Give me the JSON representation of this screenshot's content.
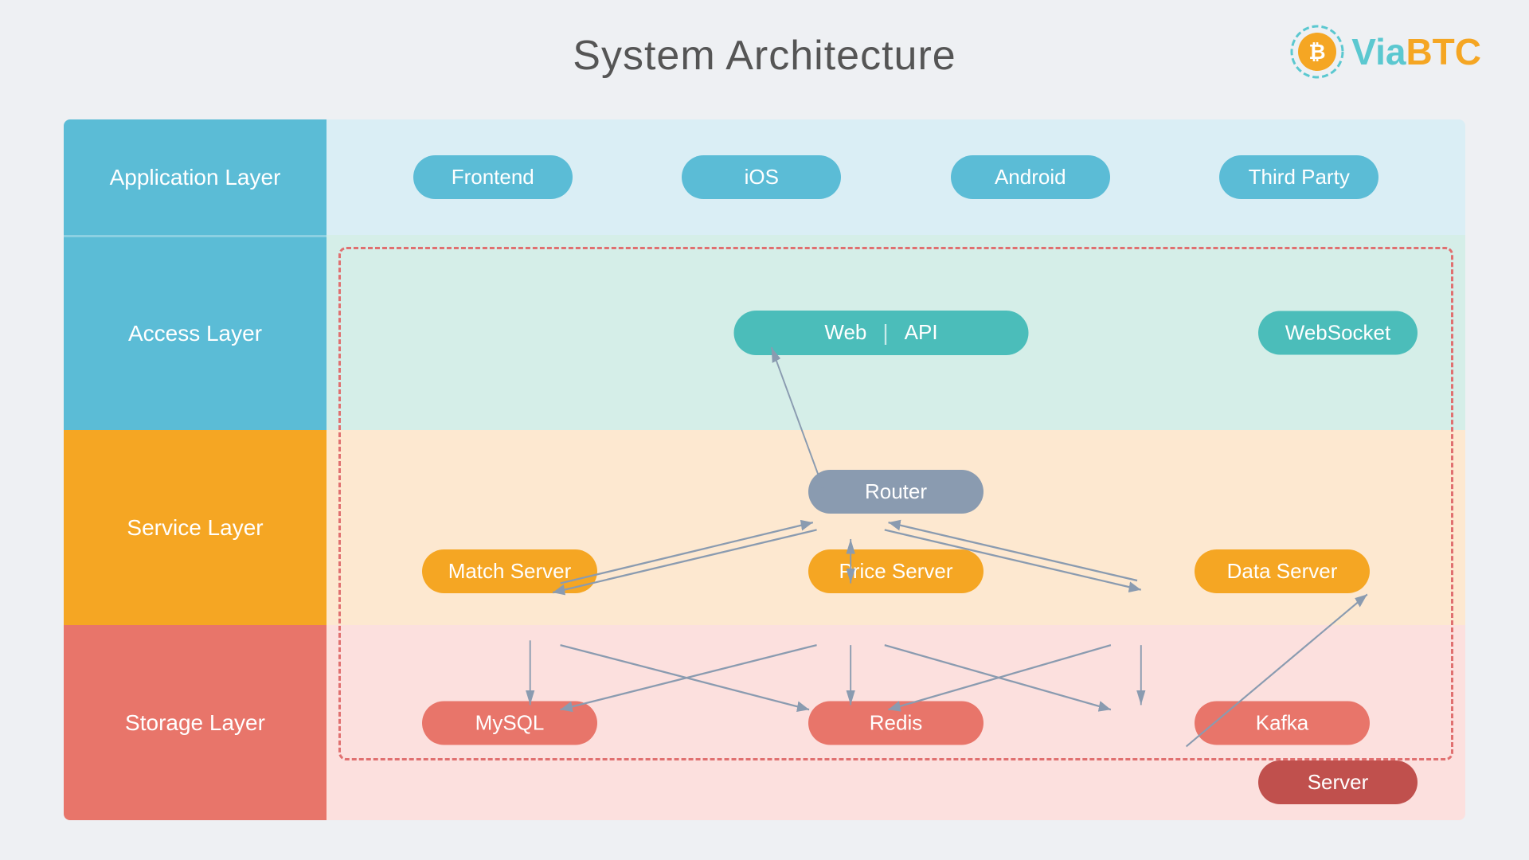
{
  "title": "System Architecture",
  "logo": {
    "via": "Via",
    "btc": "BTC"
  },
  "layers": {
    "application": "Application Layer",
    "access": "Access Layer",
    "service": "Service Layer",
    "storage": "Storage Layer"
  },
  "appItems": [
    "Frontend",
    "iOS",
    "Android",
    "Third Party"
  ],
  "accessItems": {
    "webApi": "Web  |  API",
    "websocket": "WebSocket"
  },
  "serviceItems": {
    "router": "Router",
    "matchServer": "Match Server",
    "priceServer": "Price Server",
    "dataServer": "Data Server"
  },
  "storageItems": {
    "mysql": "MySQL",
    "redis": "Redis",
    "kafka": "Kafka"
  },
  "server": "Server"
}
